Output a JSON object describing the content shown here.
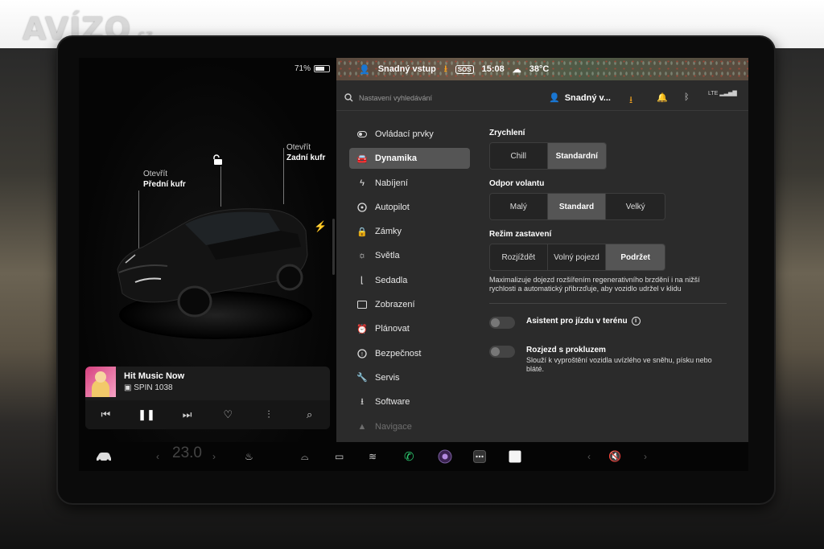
{
  "watermark": {
    "brand": "AVÍZO",
    "tld": ".cz"
  },
  "left": {
    "battery": "71%",
    "battery_level": 0.71,
    "frunk": {
      "action": "Otevřít",
      "name": "Přední kufr"
    },
    "trunk": {
      "action": "Otevřít",
      "name": "Zadní kufr"
    }
  },
  "media": {
    "title": "Hit Music Now",
    "station": "SPIN 1038"
  },
  "status": {
    "profile": "Snadný vstup",
    "sos": "SOS",
    "time": "15:08",
    "temp": "38°C"
  },
  "header": {
    "search_placeholder": "Nastavení vyhledávání",
    "user": "Snadný v...",
    "signal": "LTE"
  },
  "nav": [
    {
      "label": "Ovládací prvky",
      "icon": "toggle-icon",
      "active": false
    },
    {
      "label": "Dynamika",
      "icon": "car-icon",
      "active": true
    },
    {
      "label": "Nabíjení",
      "icon": "bolt-icon",
      "active": false
    },
    {
      "label": "Autopilot",
      "icon": "steering-wheel-icon",
      "active": false
    },
    {
      "label": "Zámky",
      "icon": "lock-icon",
      "active": false
    },
    {
      "label": "Světla",
      "icon": "sun-icon",
      "active": false
    },
    {
      "label": "Sedadla",
      "icon": "seat-icon",
      "active": false
    },
    {
      "label": "Zobrazení",
      "icon": "display-icon",
      "active": false
    },
    {
      "label": "Plánovat",
      "icon": "clock-icon",
      "active": false
    },
    {
      "label": "Bezpečnost",
      "icon": "shield-icon",
      "active": false
    },
    {
      "label": "Servis",
      "icon": "wrench-icon",
      "active": false
    },
    {
      "label": "Software",
      "icon": "download-icon",
      "active": false
    },
    {
      "label": "Navigace",
      "icon": "navigation-icon",
      "active": false
    }
  ],
  "acceleration": {
    "label": "Zrychlení",
    "options": [
      "Chill",
      "Standardní"
    ],
    "selected": "Standardní"
  },
  "steering": {
    "label": "Odpor volantu",
    "options": [
      "Malý",
      "Standard",
      "Velký"
    ],
    "selected": "Standard"
  },
  "stopping": {
    "label": "Režim zastavení",
    "options": [
      "Rozjíždět",
      "Volný pojezd",
      "Podržet"
    ],
    "selected": "Podržet",
    "description": "Maximalizuje dojezd rozšířením regenerativního brzdění i na nižší rychlosti a automatický přibrzďuje, aby vozidlo udržel v klidu"
  },
  "offroad": {
    "label": "Asistent pro jízdu v terénu",
    "enabled": false
  },
  "slip": {
    "label": "Rozjezd s prokluzem",
    "description": "Slouží k vyproštění vozidla uvízlého ve sněhu, písku nebo bláté.",
    "enabled": false
  },
  "dock": {
    "temperature": "23.0"
  },
  "colors": {
    "accent_orange": "#f0a020",
    "phone_green": "#2ecc71",
    "active_segment": "#555555"
  }
}
